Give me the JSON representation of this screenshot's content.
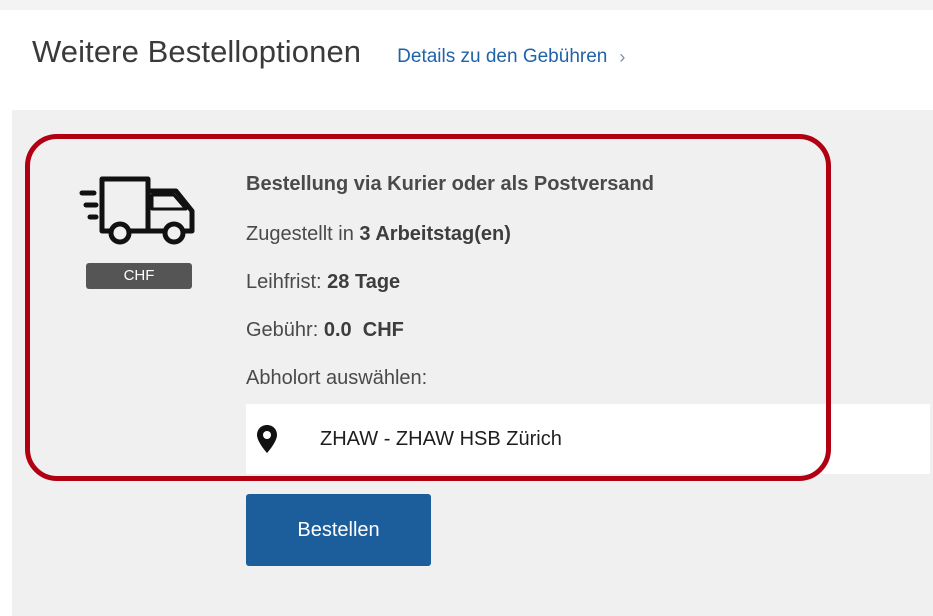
{
  "header": {
    "title": "Weitere Bestelloptionen",
    "details_link": "Details zu den Gebühren",
    "details_chevron": "›"
  },
  "option": {
    "icon": "truck-icon",
    "badge": "CHF",
    "title": "Bestellung via Kurier oder als Postversand",
    "delivery_prefix": "Zugestellt in",
    "delivery_value": "3 Arbeitstag(en)",
    "loan_prefix": "Leihfrist:",
    "loan_value": "28 Tage",
    "fee_prefix": "Gebühr:",
    "fee_value": "0.0  CHF",
    "pickup_label": "Abholort auswählen:",
    "pickup_selected": "ZHAW - ZHAW HSB Zürich",
    "pickup_icon": "location-pin-icon",
    "order_button": "Bestellen"
  },
  "colors": {
    "link": "#1f63a8",
    "button": "#1c5d9c",
    "badge": "#555555",
    "highlight": "#b00012",
    "card_background": "#f0f0f0"
  }
}
